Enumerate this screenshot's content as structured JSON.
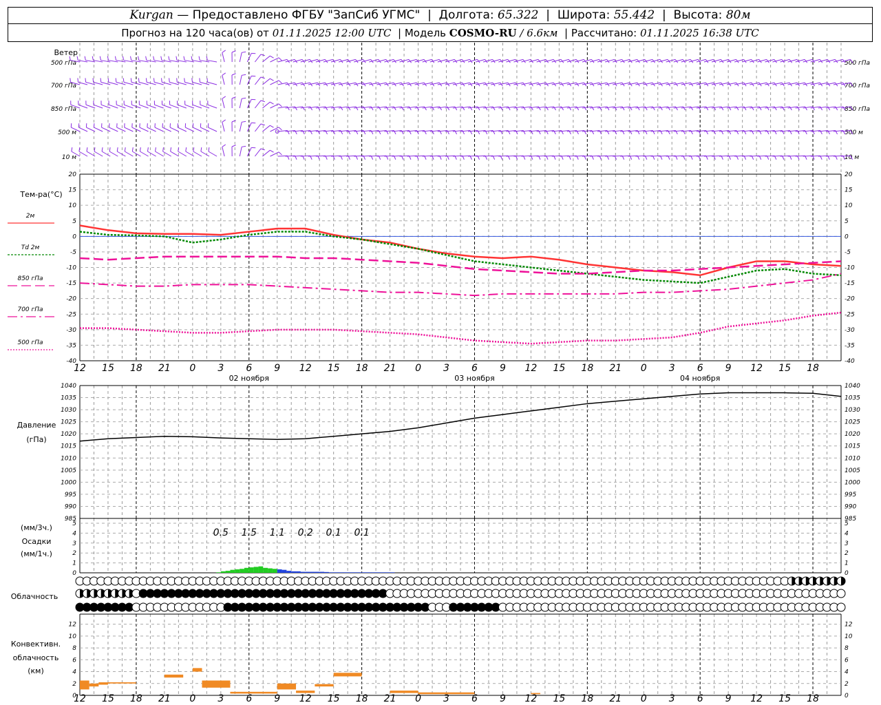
{
  "header": {
    "city": "Kurgan",
    "dash": " — ",
    "provider": "Предоставлено ФГБУ \"ЗапСиб УГМС\"",
    "lon_label": "Долгота:",
    "lon": "65.322",
    "lat_label": "Широта:",
    "lat": "55.442",
    "alt_label": "Высота:",
    "alt": "80м",
    "forecast_label": "Прогноз на 120 часа(ов) от",
    "forecast_time": "01.11.2025 12:00 UTC",
    "model_label": "Модель",
    "model_name": "COSMO-RU",
    "model_res": "/ 6.6км",
    "calc_label": "Рассчитано:",
    "calc_time": "01.11.2025 16:38 UTC"
  },
  "wind": {
    "title": "Ветер",
    "levels": [
      "500 гПа",
      "700 гПа",
      "850 гПа",
      "500 м",
      "10  м"
    ],
    "levels_right": [
      "500 гПа",
      "700 гПа",
      "850 гПа",
      "500 м",
      "10 м"
    ],
    "color": "#8a2be2"
  },
  "temp": {
    "title": "Тем-ра(°C)",
    "legend": [
      "2м",
      "Td  2м",
      "850 гПа",
      "700 гПа",
      "500 гПа"
    ],
    "yticks": [
      20,
      15,
      10,
      5,
      0,
      -5,
      -10,
      -15,
      -20,
      -25,
      -30,
      -35,
      -40
    ]
  },
  "time_axis": {
    "ticks": [
      "12",
      "15",
      "18",
      "21",
      "0",
      "3",
      "6",
      "9",
      "12",
      "15",
      "18",
      "21",
      "0",
      "3",
      "6",
      "9",
      "12",
      "15",
      "18",
      "21",
      "0",
      "3",
      "6",
      "9",
      "12",
      "15",
      "18"
    ],
    "dates": [
      "02 ноября",
      "03 ноября",
      "04 ноября"
    ]
  },
  "pressure": {
    "title": "Давление",
    "unit": "(гПа)",
    "yticks": [
      1040,
      1035,
      1030,
      1025,
      1020,
      1015,
      1010,
      1005,
      1000,
      995,
      990,
      985
    ]
  },
  "precip": {
    "label1": "(мм/3ч.)",
    "label2": "Осадки",
    "label3": "(мм/1ч.)",
    "yticks": [
      5,
      4,
      3,
      2,
      1,
      0
    ],
    "sums": [
      "0.5",
      "1.5",
      "1.1",
      "0.2",
      "0.1",
      "0.1"
    ]
  },
  "cloud": {
    "title": "Облачность"
  },
  "conv": {
    "title1": "Конвективн.",
    "title2": "облачность",
    "title3": "(км)",
    "yticks": [
      12,
      10,
      8,
      6,
      4,
      2,
      0
    ],
    "color": "#f08a24"
  },
  "chart_data": [
    {
      "type": "line",
      "title": "Тем-ра(°C)",
      "x_hours_from_start": [
        0,
        6,
        12,
        18,
        24,
        30,
        36,
        42,
        48,
        54,
        60,
        66,
        72,
        78,
        84,
        90,
        96,
        102,
        108,
        114,
        120,
        126,
        132,
        138,
        144,
        150,
        156,
        162
      ],
      "series": [
        {
          "name": "2м",
          "color": "#ff3333",
          "values": [
            3.5,
            2,
            1,
            0.8,
            0.8,
            0.5,
            1.5,
            2.5,
            2.5,
            0.5,
            -1,
            -2,
            -4,
            -5.5,
            -6.5,
            -7,
            -6.5,
            -7.5,
            -9,
            -10,
            -11,
            -11.5,
            -12.5,
            -10,
            -8,
            -8,
            -9,
            -9.5
          ]
        },
        {
          "name": "Td  2м",
          "color": "#008800",
          "values": [
            1.5,
            0.5,
            0.3,
            0,
            -2,
            -1,
            0.5,
            1.5,
            1.5,
            0,
            -1,
            -2.5,
            -4,
            -6,
            -8,
            -9,
            -10,
            -11,
            -12,
            -13,
            -14,
            -14.5,
            -15,
            -13,
            -11,
            -10.5,
            -12,
            -12.5
          ]
        },
        {
          "name": "850 гПа",
          "color": "#ee1199",
          "values": [
            -7,
            -7.5,
            -7,
            -6.5,
            -6.5,
            -6.5,
            -6.5,
            -6.5,
            -7,
            -7,
            -7.5,
            -8,
            -8.5,
            -9.5,
            -10.5,
            -11,
            -11.5,
            -12,
            -12,
            -11.5,
            -11,
            -11,
            -10.5,
            -10,
            -9.5,
            -9,
            -8.5,
            -8
          ]
        },
        {
          "name": "700 гПа",
          "color": "#ee1199",
          "values": [
            -15,
            -15.5,
            -16,
            -16,
            -15.5,
            -15.5,
            -15.5,
            -16,
            -16.5,
            -17,
            -17.5,
            -18,
            -18,
            -18.5,
            -19,
            -18.5,
            -18.5,
            -18.5,
            -18.5,
            -18.5,
            -18,
            -18,
            -17.5,
            -17,
            -16,
            -15,
            -14,
            -12
          ]
        },
        {
          "name": "500 гПа",
          "color": "#ee1199",
          "values": [
            -29.5,
            -29.5,
            -30,
            -30.5,
            -31,
            -31,
            -30.5,
            -30,
            -30,
            -30,
            -30.5,
            -31,
            -31.5,
            -32.5,
            -33.5,
            -34,
            -34.5,
            -34,
            -33.5,
            -33.5,
            -33,
            -32.5,
            -31,
            -29,
            -28,
            -27,
            -25.5,
            -24.5
          ]
        }
      ],
      "ylim": [
        -40,
        20
      ]
    },
    {
      "type": "line",
      "title": "Давление",
      "ylabel": "(гПа)",
      "x_hours_from_start": [
        0,
        6,
        12,
        18,
        24,
        30,
        36,
        42,
        48,
        54,
        60,
        66,
        72,
        78,
        84,
        90,
        96,
        102,
        108,
        114,
        120,
        126,
        132,
        138,
        144,
        150,
        156,
        162
      ],
      "series": [
        {
          "color": "#000000",
          "values": [
            1017,
            1018,
            1018.5,
            1019,
            1018.8,
            1018.3,
            1018,
            1017.7,
            1018,
            1019,
            1020,
            1021,
            1022.5,
            1024.5,
            1026.5,
            1028,
            1029.5,
            1031,
            1032.5,
            1033.5,
            1034.5,
            1035.5,
            1036.5,
            1037,
            1037,
            1037,
            1036.8,
            1035.5
          ]
        }
      ],
      "ylim": [
        985,
        1040
      ]
    },
    {
      "type": "bar",
      "title": "Осадки",
      "ylabel": "(мм/1ч.)",
      "x_hours_from_start": [
        18,
        19,
        20,
        21,
        22,
        23,
        24,
        25,
        26,
        27,
        28,
        29,
        30,
        31,
        32,
        33,
        34,
        35,
        36,
        37,
        38,
        39,
        40,
        41,
        42,
        43,
        44,
        45,
        46,
        47,
        48,
        49,
        50,
        51,
        52,
        53,
        54,
        55,
        56,
        57,
        58,
        59,
        60,
        61,
        62,
        63,
        64,
        65,
        66
      ],
      "values": [
        0,
        0,
        0,
        0,
        0,
        0,
        0,
        0,
        0,
        0,
        0,
        0.05,
        0.15,
        0.2,
        0.3,
        0.35,
        0.4,
        0.5,
        0.55,
        0.6,
        0.65,
        0.5,
        0.45,
        0.4,
        0.35,
        0.3,
        0.2,
        0.15,
        0.15,
        0.1,
        0.1,
        0.1,
        0.1,
        0.1,
        0.08,
        0.05,
        0.05,
        0.05,
        0.05,
        0.05,
        0.05,
        0.05,
        0.05,
        0.05,
        0.05,
        0.05,
        0.05,
        0.05,
        0.05
      ],
      "ylim": [
        0,
        5
      ]
    }
  ]
}
